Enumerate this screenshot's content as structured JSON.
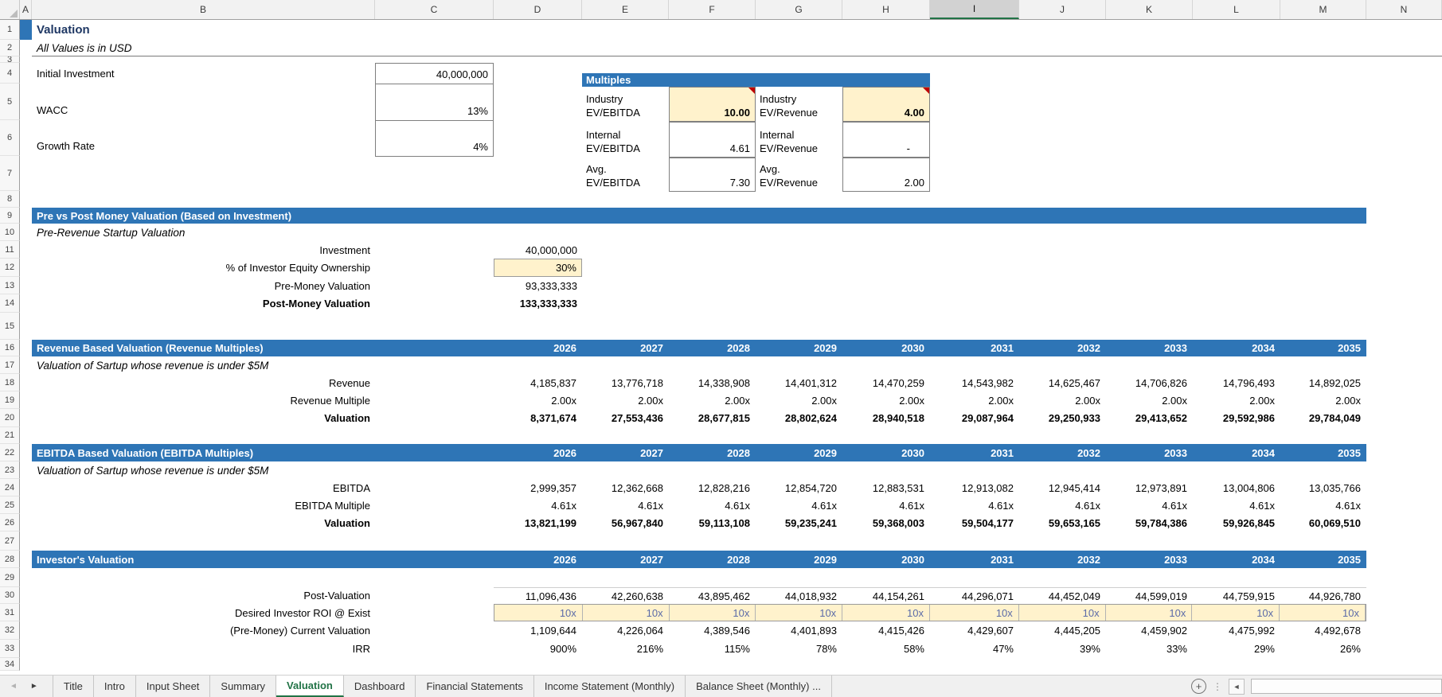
{
  "grid": {
    "columns": [
      "A",
      "B",
      "C",
      "D",
      "E",
      "F",
      "G",
      "H",
      "I",
      "J",
      "K",
      "L",
      "M",
      "N"
    ],
    "selected_column": "I",
    "rows": [
      "1",
      "2",
      "3",
      "4",
      "5",
      "6",
      "7",
      "8",
      "9",
      "10",
      "11",
      "12",
      "13",
      "14",
      "15",
      "16",
      "17",
      "18",
      "19",
      "20",
      "21",
      "22",
      "23",
      "24",
      "25",
      "26",
      "27",
      "28",
      "29",
      "30",
      "31",
      "32",
      "33",
      "34"
    ]
  },
  "title": {
    "heading": "Valuation",
    "subtitle": "All Values is in USD"
  },
  "assumptions": {
    "rows": [
      {
        "label": "Initial Investment",
        "value": "40,000,000"
      },
      {
        "label": "WACC",
        "value": "13%"
      },
      {
        "label": "Growth Rate",
        "value": "4%"
      }
    ]
  },
  "multiples": {
    "header": "Multiples",
    "rows": [
      {
        "l1": "Industry",
        "l2": "EV/EBITDA",
        "v1": "10.00",
        "r1": "Industry",
        "r2": "EV/Revenue",
        "v2": "4.00"
      },
      {
        "l1": "Internal",
        "l2": "EV/EBITDA",
        "v1": "4.61",
        "r1": "Internal",
        "r2": "EV/Revenue",
        "v2": "-"
      },
      {
        "l1": "Avg.",
        "l2": "EV/EBITDA",
        "v1": "7.30",
        "r1": "Avg.",
        "r2": "EV/Revenue",
        "v2": "2.00"
      }
    ]
  },
  "prepost": {
    "header": "Pre vs Post Money Valuation (Based on Investment)",
    "note": "Pre-Revenue Startup Valuation",
    "rows": [
      {
        "label": "Investment",
        "value": "40,000,000"
      },
      {
        "label": "% of Investor Equity Ownership",
        "value": "30%"
      },
      {
        "label": "Pre-Money Valuation",
        "value": "93,333,333"
      },
      {
        "label": "Post-Money Valuation",
        "value": "133,333,333"
      }
    ]
  },
  "years": [
    "2026",
    "2027",
    "2028",
    "2029",
    "2030",
    "2031",
    "2032",
    "2033",
    "2034",
    "2035"
  ],
  "revenue_section": {
    "header": "Revenue Based Valuation (Revenue Multiples)",
    "note": "Valuation of Sartup whose revenue is under $5M",
    "revenue": {
      "label": "Revenue",
      "values": [
        "4,185,837",
        "13,776,718",
        "14,338,908",
        "14,401,312",
        "14,470,259",
        "14,543,982",
        "14,625,467",
        "14,706,826",
        "14,796,493",
        "14,892,025"
      ]
    },
    "multiple": {
      "label": "Revenue Multiple",
      "values": [
        "2.00x",
        "2.00x",
        "2.00x",
        "2.00x",
        "2.00x",
        "2.00x",
        "2.00x",
        "2.00x",
        "2.00x",
        "2.00x"
      ]
    },
    "valuation": {
      "label": "Valuation",
      "values": [
        "8,371,674",
        "27,553,436",
        "28,677,815",
        "28,802,624",
        "28,940,518",
        "29,087,964",
        "29,250,933",
        "29,413,652",
        "29,592,986",
        "29,784,049"
      ]
    }
  },
  "ebitda_section": {
    "header": "EBITDA Based Valuation (EBITDA Multiples)",
    "note": "Valuation of Sartup whose revenue is under $5M",
    "ebitda": {
      "label": "EBITDA",
      "values": [
        "2,999,357",
        "12,362,668",
        "12,828,216",
        "12,854,720",
        "12,883,531",
        "12,913,082",
        "12,945,414",
        "12,973,891",
        "13,004,806",
        "13,035,766"
      ]
    },
    "multiple": {
      "label": "EBITDA Multiple",
      "values": [
        "4.61x",
        "4.61x",
        "4.61x",
        "4.61x",
        "4.61x",
        "4.61x",
        "4.61x",
        "4.61x",
        "4.61x",
        "4.61x"
      ]
    },
    "valuation": {
      "label": "Valuation",
      "values": [
        "13,821,199",
        "56,967,840",
        "59,113,108",
        "59,235,241",
        "59,368,003",
        "59,504,177",
        "59,653,165",
        "59,784,386",
        "59,926,845",
        "60,069,510"
      ]
    }
  },
  "investor_section": {
    "header": "Investor's Valuation",
    "post_valuation": {
      "label": "Post-Valuation",
      "values": [
        "11,096,436",
        "42,260,638",
        "43,895,462",
        "44,018,932",
        "44,154,261",
        "44,296,071",
        "44,452,049",
        "44,599,019",
        "44,759,915",
        "44,926,780"
      ]
    },
    "roi": {
      "label": "Desired Investor ROI @ Exist",
      "values": [
        "10x",
        "10x",
        "10x",
        "10x",
        "10x",
        "10x",
        "10x",
        "10x",
        "10x",
        "10x"
      ]
    },
    "current_valuation": {
      "label": "(Pre-Money) Current Valuation",
      "values": [
        "1,109,644",
        "4,226,064",
        "4,389,546",
        "4,401,893",
        "4,415,426",
        "4,429,607",
        "4,445,205",
        "4,459,902",
        "4,475,992",
        "4,492,678"
      ]
    },
    "irr": {
      "label": "IRR",
      "values": [
        "900%",
        "216%",
        "115%",
        "78%",
        "58%",
        "47%",
        "39%",
        "33%",
        "29%",
        "26%"
      ]
    }
  },
  "tabs": {
    "items": [
      "Title",
      "Intro",
      "Input Sheet",
      "Summary",
      "Valuation",
      "Dashboard",
      "Financial Statements",
      "Income Statement (Monthly)",
      "Balance Sheet (Monthly) ..."
    ],
    "active_index": 4
  },
  "icons": {
    "tabs_left": "◄",
    "tabs_right": "►",
    "add_sheet": "+",
    "dots": "⋮",
    "hscroll_left": "◄"
  },
  "colors": {
    "section_bar": "#2E75B6",
    "input_fill": "#FFF2CC",
    "title_navy": "#1F3864",
    "active_tab_green": "#217346",
    "comment_marker": "#C00000"
  }
}
